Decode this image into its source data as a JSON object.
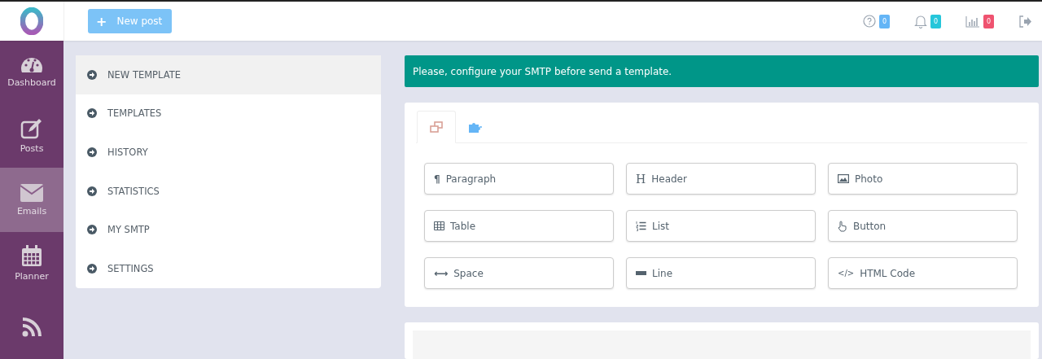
{
  "topbar": {
    "new_post": {
      "icon": "+",
      "label": "New post"
    },
    "indicators": [
      {
        "kind": "help",
        "count": "0",
        "color": "#64b5f6"
      },
      {
        "kind": "bell",
        "count": "0",
        "color": "#26c6da"
      },
      {
        "kind": "chart",
        "count": "0",
        "color": "#ef5370"
      }
    ]
  },
  "rail": [
    {
      "kind": "dashboard",
      "label": "Dashboard",
      "selected": false
    },
    {
      "kind": "posts",
      "label": "Posts",
      "selected": false
    },
    {
      "kind": "emails",
      "label": "Emails",
      "selected": true
    },
    {
      "kind": "planner",
      "label": "Planner",
      "selected": false
    },
    {
      "kind": "rss",
      "selected": false
    }
  ],
  "menu": [
    {
      "label": "NEW TEMPLATE",
      "selected": true
    },
    {
      "label": "TEMPLATES",
      "selected": false
    },
    {
      "label": "HISTORY",
      "selected": false
    },
    {
      "label": "STATISTICS",
      "selected": false
    },
    {
      "label": "MY SMTP",
      "selected": false
    },
    {
      "label": "SETTINGS",
      "selected": false
    }
  ],
  "alert": "Please, configure your SMTP before send a template.",
  "tabs": [
    {
      "kind": "blocks",
      "selected": true
    },
    {
      "kind": "plugins",
      "selected": false
    }
  ],
  "blocks": [
    {
      "kind": "paragraph",
      "icon": "¶",
      "label": "Paragraph"
    },
    {
      "kind": "header",
      "icon": "H",
      "label": "Header"
    },
    {
      "kind": "photo",
      "label": "Photo"
    },
    {
      "kind": "table",
      "label": "Table"
    },
    {
      "kind": "list",
      "label": "List"
    },
    {
      "kind": "button",
      "label": "Button"
    },
    {
      "kind": "space",
      "icon": "⟷",
      "label": "Space"
    },
    {
      "kind": "line",
      "label": "Line"
    },
    {
      "kind": "code",
      "icon": "</>",
      "label": "HTML Code"
    }
  ]
}
